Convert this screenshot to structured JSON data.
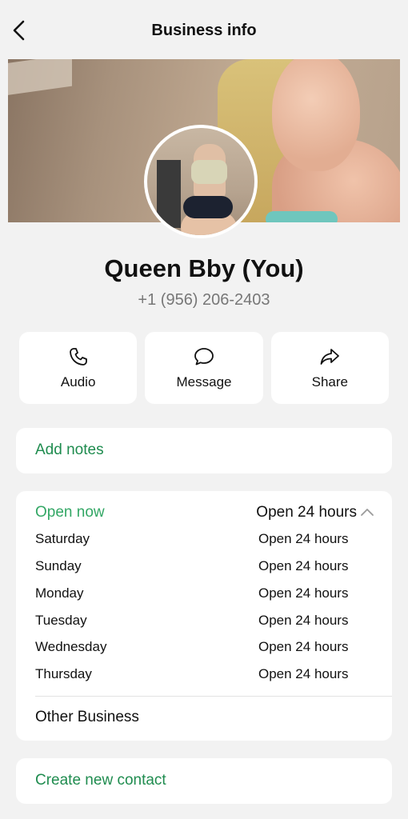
{
  "header": {
    "title": "Business info",
    "back_icon": "chevron-left-icon"
  },
  "profile": {
    "name": "Queen Bby (You)",
    "phone": "+1 (956) 206-2403"
  },
  "actions": [
    {
      "label": "Audio",
      "icon": "phone-icon"
    },
    {
      "label": "Message",
      "icon": "chat-bubble-icon"
    },
    {
      "label": "Share",
      "icon": "share-arrow-icon"
    }
  ],
  "notes": {
    "label": "Add notes"
  },
  "hours": {
    "status": "Open now",
    "summary": "Open 24 hours",
    "days": [
      {
        "day": "Saturday",
        "hours": "Open 24 hours"
      },
      {
        "day": "Sunday",
        "hours": "Open 24 hours"
      },
      {
        "day": "Monday",
        "hours": "Open 24 hours"
      },
      {
        "day": "Tuesday",
        "hours": "Open 24 hours"
      },
      {
        "day": "Wednesday",
        "hours": "Open 24 hours"
      },
      {
        "day": "Thursday",
        "hours": "Open 24 hours"
      }
    ],
    "category": "Other Business"
  },
  "create_contact": {
    "label": "Create new contact"
  },
  "colors": {
    "accent_green": "#1f8c4f",
    "open_green": "#33a765",
    "background": "#f2f2f2"
  }
}
